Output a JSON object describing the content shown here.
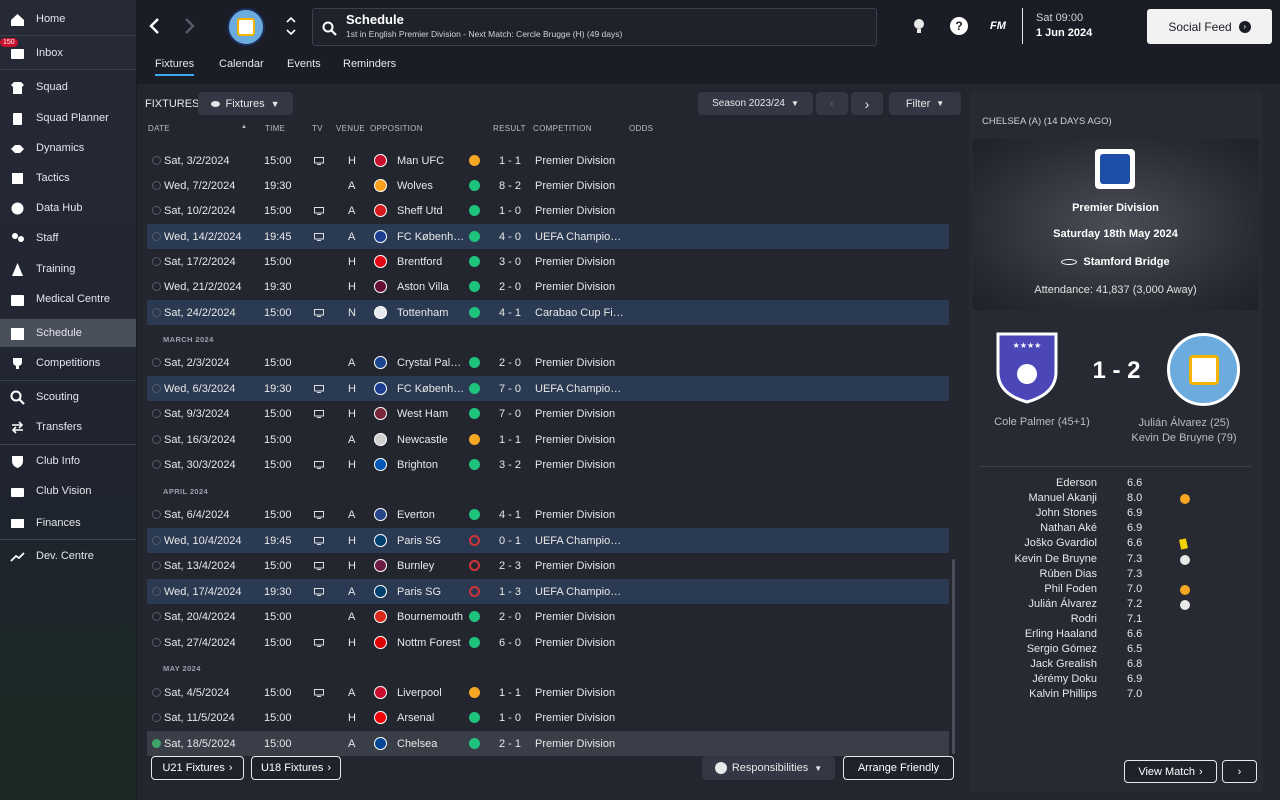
{
  "sidebar": {
    "items": [
      {
        "label": "Home",
        "icon": "home-icon"
      },
      {
        "label": "Inbox",
        "icon": "inbox-icon",
        "badge": "150"
      },
      {
        "label": "Squad",
        "icon": "shirt-icon"
      },
      {
        "label": "Squad Planner",
        "icon": "clipboard-icon"
      },
      {
        "label": "Dynamics",
        "icon": "handshake-icon"
      },
      {
        "label": "Tactics",
        "icon": "tactics-board-icon"
      },
      {
        "label": "Data Hub",
        "icon": "globe-icon"
      },
      {
        "label": "Staff",
        "icon": "people-icon"
      },
      {
        "label": "Training",
        "icon": "cone-icon"
      },
      {
        "label": "Medical Centre",
        "icon": "medical-kit-icon"
      },
      {
        "label": "Schedule",
        "icon": "calendar-icon"
      },
      {
        "label": "Competitions",
        "icon": "trophy-icon"
      },
      {
        "label": "Scouting",
        "icon": "magnifier-icon"
      },
      {
        "label": "Transfers",
        "icon": "transfer-arrows-icon"
      },
      {
        "label": "Club Info",
        "icon": "shield-icon"
      },
      {
        "label": "Club Vision",
        "icon": "briefcase-icon"
      },
      {
        "label": "Finances",
        "icon": "money-icon"
      },
      {
        "label": "Dev. Centre",
        "icon": "growth-icon"
      }
    ]
  },
  "header": {
    "title": "Schedule",
    "subtitle": "1st in English Premier Division - Next Match: Cercle Brugge (H) (49 days)",
    "logo_text": "FM",
    "datetime": "Sat 09:00",
    "date": "1 Jun 2024",
    "social_feed": "Social Feed"
  },
  "tabs": [
    {
      "label": "Fixtures",
      "active": true
    },
    {
      "label": "Calendar"
    },
    {
      "label": "Events"
    },
    {
      "label": "Reminders"
    }
  ],
  "toolbar": {
    "fixtures_label": "FIXTURES",
    "view_dropdown": "Fixtures",
    "season": "Season 2023/24",
    "filter": "Filter"
  },
  "columns": {
    "date": "DATE",
    "time": "TIME",
    "tv": "TV",
    "venue": "VENUE",
    "opposition": "OPPOSITION",
    "result": "RESULT",
    "competition": "COMPETITION",
    "odds": "ODDS"
  },
  "months": [
    "MARCH 2024",
    "APRIL 2024",
    "MAY 2024"
  ],
  "fixtures": [
    {
      "date": "Sat, 3/2/2024",
      "time": "15:00",
      "tv": true,
      "venue": "H",
      "opp": "Man UFC",
      "outcome": "D",
      "result": "1 - 1",
      "comp": "Premier Division",
      "crest": "#c8102e"
    },
    {
      "date": "Wed, 7/2/2024",
      "time": "19:30",
      "tv": false,
      "venue": "A",
      "opp": "Wolves",
      "outcome": "W",
      "result": "8 - 2",
      "comp": "Premier Division",
      "crest": "#f9a01b"
    },
    {
      "date": "Sat, 10/2/2024",
      "time": "15:00",
      "tv": true,
      "venue": "A",
      "opp": "Sheff Utd",
      "outcome": "W",
      "result": "1 - 0",
      "comp": "Premier Division",
      "crest": "#d71920"
    },
    {
      "date": "Wed, 14/2/2024",
      "time": "19:45",
      "tv": true,
      "venue": "A",
      "opp": "FC København",
      "outcome": "W",
      "result": "4 - 0",
      "comp": "UEFA Champions League",
      "crest": "#1c3f94",
      "hl": true
    },
    {
      "date": "Sat, 17/2/2024",
      "time": "15:00",
      "tv": false,
      "venue": "H",
      "opp": "Brentford",
      "outcome": "W",
      "result": "3 - 0",
      "comp": "Premier Division",
      "crest": "#e30613"
    },
    {
      "date": "Wed, 21/2/2024",
      "time": "19:30",
      "tv": false,
      "venue": "H",
      "opp": "Aston Villa",
      "outcome": "W",
      "result": "2 - 0",
      "comp": "Premier Division",
      "crest": "#670e36"
    },
    {
      "date": "Sat, 24/2/2024",
      "time": "15:00",
      "tv": true,
      "venue": "N",
      "opp": "Tottenham",
      "outcome": "W",
      "result": "4 - 1",
      "comp": "Carabao Cup Final",
      "crest": "#e8e8f0",
      "hl": true
    },
    {
      "date": "Sat, 2/3/2024",
      "time": "15:00",
      "tv": false,
      "venue": "A",
      "opp": "Crystal Palace",
      "outcome": "W",
      "result": "2 - 0",
      "comp": "Premier Division",
      "crest": "#1b458f"
    },
    {
      "date": "Wed, 6/3/2024",
      "time": "19:30",
      "tv": true,
      "venue": "H",
      "opp": "FC København",
      "outcome": "W",
      "result": "7 - 0",
      "comp": "UEFA Champions League",
      "crest": "#1c3f94",
      "hl": true
    },
    {
      "date": "Sat, 9/3/2024",
      "time": "15:00",
      "tv": true,
      "venue": "H",
      "opp": "West Ham",
      "outcome": "W",
      "result": "7 - 0",
      "comp": "Premier Division",
      "crest": "#7a263a"
    },
    {
      "date": "Sat, 16/3/2024",
      "time": "15:00",
      "tv": false,
      "venue": "A",
      "opp": "Newcastle",
      "outcome": "D",
      "result": "1 - 1",
      "comp": "Premier Division",
      "crest": "#d0d0d0"
    },
    {
      "date": "Sat, 30/3/2024",
      "time": "15:00",
      "tv": true,
      "venue": "H",
      "opp": "Brighton",
      "outcome": "W",
      "result": "3 - 2",
      "comp": "Premier Division",
      "crest": "#0057b8"
    },
    {
      "date": "Sat, 6/4/2024",
      "time": "15:00",
      "tv": true,
      "venue": "A",
      "opp": "Everton",
      "outcome": "W",
      "result": "4 - 1",
      "comp": "Premier Division",
      "crest": "#274488"
    },
    {
      "date": "Wed, 10/4/2024",
      "time": "19:45",
      "tv": true,
      "venue": "H",
      "opp": "Paris SG",
      "outcome": "L",
      "result": "0 - 1",
      "comp": "UEFA Champions League",
      "crest": "#004170",
      "hl": true
    },
    {
      "date": "Sat, 13/4/2024",
      "time": "15:00",
      "tv": true,
      "venue": "H",
      "opp": "Burnley",
      "outcome": "L",
      "result": "2 - 3",
      "comp": "Premier Division",
      "crest": "#6c1d45"
    },
    {
      "date": "Wed, 17/4/2024",
      "time": "19:30",
      "tv": true,
      "venue": "A",
      "opp": "Paris SG",
      "outcome": "L",
      "result": "1 - 3",
      "comp": "UEFA Champions League",
      "crest": "#004170",
      "hl": true
    },
    {
      "date": "Sat, 20/4/2024",
      "time": "15:00",
      "tv": false,
      "venue": "A",
      "opp": "Bournemouth",
      "outcome": "W",
      "result": "2 - 0",
      "comp": "Premier Division",
      "crest": "#da291c"
    },
    {
      "date": "Sat, 27/4/2024",
      "time": "15:00",
      "tv": true,
      "venue": "H",
      "opp": "Nottm Forest",
      "outcome": "W",
      "result": "6 - 0",
      "comp": "Premier Division",
      "crest": "#dd0000"
    },
    {
      "date": "Sat, 4/5/2024",
      "time": "15:00",
      "tv": true,
      "venue": "A",
      "opp": "Liverpool",
      "outcome": "D",
      "result": "1 - 1",
      "comp": "Premier Division",
      "crest": "#c8102e"
    },
    {
      "date": "Sat, 11/5/2024",
      "time": "15:00",
      "tv": false,
      "venue": "H",
      "opp": "Arsenal",
      "outcome": "W",
      "result": "1 - 0",
      "comp": "Premier Division",
      "crest": "#ef0107"
    },
    {
      "date": "Sat, 18/5/2024",
      "time": "15:00",
      "tv": false,
      "venue": "A",
      "opp": "Chelsea",
      "outcome": "W",
      "result": "2 - 1",
      "comp": "Premier Division",
      "crest": "#034694",
      "sel": true
    }
  ],
  "bottom": {
    "u21": "U21 Fixtures",
    "u18": "U18 Fixtures",
    "responsibilities": "Responsibilities",
    "arrange": "Arrange Friendly"
  },
  "match": {
    "header": "CHELSEA (A) (14 DAYS AGO)",
    "competition": "Premier Division",
    "date": "Saturday 18th May 2024",
    "stadium": "Stamford Bridge",
    "attendance": "Attendance: 41,837 (3,000 Away)",
    "score": "1 - 2",
    "home_scorers": [
      "Cole Palmer (45+1)"
    ],
    "away_scorers": [
      "Julián Álvarez (25)",
      "Kevin De Bruyne (79)"
    ],
    "view_match": "View Match",
    "players": [
      {
        "name": "Ederson",
        "rating": "6.6",
        "icon": ""
      },
      {
        "name": "Manuel Akanji",
        "rating": "8.0",
        "icon": "star"
      },
      {
        "name": "John Stones",
        "rating": "6.9",
        "icon": ""
      },
      {
        "name": "Nathan Aké",
        "rating": "6.9",
        "icon": ""
      },
      {
        "name": "Joško Gvardiol",
        "rating": "6.6",
        "icon": "yellow"
      },
      {
        "name": "Kevin De Bruyne",
        "rating": "7.3",
        "icon": "ball"
      },
      {
        "name": "Rúben Dias",
        "rating": "7.3",
        "icon": ""
      },
      {
        "name": "Phil Foden",
        "rating": "7.0",
        "icon": "star"
      },
      {
        "name": "Julián Álvarez",
        "rating": "7.2",
        "icon": "ball"
      },
      {
        "name": "Rodri",
        "rating": "7.1",
        "icon": ""
      },
      {
        "name": "Erling Haaland",
        "rating": "6.6",
        "icon": ""
      },
      {
        "name": "Sergio Gómez",
        "rating": "6.5",
        "icon": ""
      },
      {
        "name": "Jack Grealish",
        "rating": "6.8",
        "icon": ""
      },
      {
        "name": "Jérémy Doku",
        "rating": "6.9",
        "icon": ""
      },
      {
        "name": "Kalvin Phillips",
        "rating": "7.0",
        "icon": ""
      }
    ]
  },
  "colors": {
    "win": "#1fc27c",
    "draw": "#f5a623",
    "loss": "#d0343a",
    "highlight_row": "#2a3a52",
    "active_tab": "#3fa9f5",
    "away_crest": "#6cabdd",
    "home_crest": "#4b47b8"
  }
}
